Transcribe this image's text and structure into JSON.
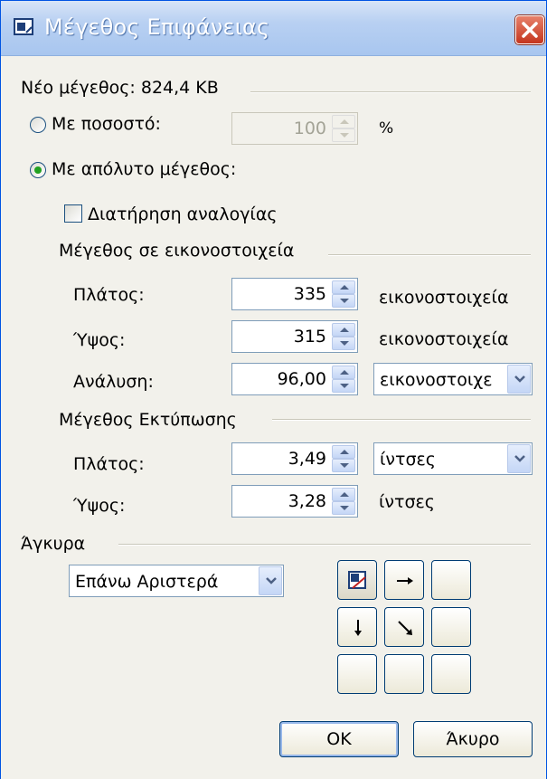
{
  "window": {
    "title": "Μέγεθος Επιφάνειας"
  },
  "new_size": "Νέο μέγεθος: 824,4 KB",
  "by_percent": {
    "label": "Με ποσοστό:",
    "value": "100",
    "unit": "%",
    "selected": false
  },
  "by_absolute": {
    "label": "Με απόλυτο μέγεθος:",
    "selected": true
  },
  "keep_ratio": {
    "label": "Διατήρηση αναλογίας",
    "checked": false
  },
  "pixel_size": {
    "header": "Μέγεθος σε εικονοστοιχεία",
    "width": {
      "label": "Πλάτος:",
      "value": "335",
      "unit": "εικονοστοιχεία"
    },
    "height": {
      "label": "Ύψος:",
      "value": "315",
      "unit": "εικονοστοιχεία"
    },
    "resolution": {
      "label": "Ανάλυση:",
      "value": "96,00",
      "unit": "εικονοστοιχε"
    }
  },
  "print_size": {
    "header": "Μέγεθος Εκτύπωσης",
    "width": {
      "label": "Πλάτος:",
      "value": "3,49",
      "unit": "ίντσες"
    },
    "height": {
      "label": "Ύψος:",
      "value": "3,28",
      "unit": "ίντσες"
    }
  },
  "anchor": {
    "header": "Άγκυρα",
    "selected": "Επάνω Αριστερά"
  },
  "buttons": {
    "ok": "OK",
    "cancel": "Άκυρο"
  }
}
